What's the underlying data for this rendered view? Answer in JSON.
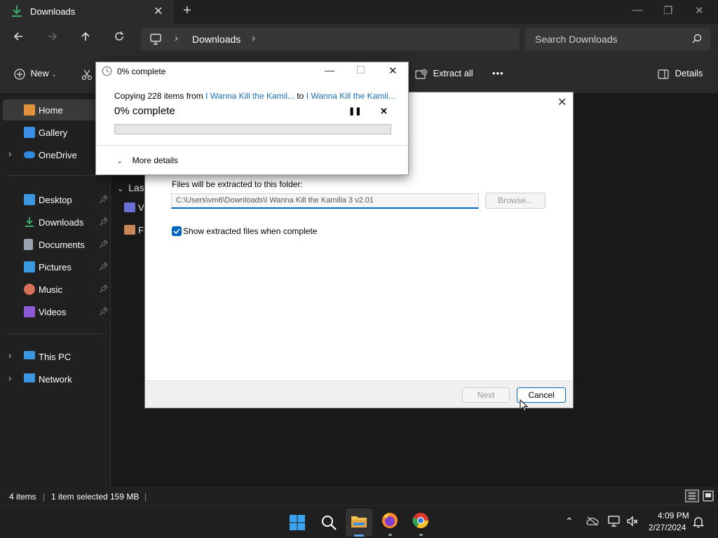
{
  "titlebar": {
    "tab_label": "Downloads",
    "new_tab": "+",
    "minimize": "—",
    "maximize": "❐",
    "close": "✕"
  },
  "address": {
    "breadcrumb": "Downloads",
    "search_placeholder": "Search Downloads"
  },
  "commands": {
    "new_label": "New",
    "extract_all": "Extract all",
    "more": "•••",
    "details": "Details"
  },
  "sidebar": {
    "items": [
      {
        "label": "Home",
        "icon": "home-icon",
        "color": "#e0913a"
      },
      {
        "label": "Gallery",
        "icon": "gallery-icon",
        "color": "#3a8ee6"
      },
      {
        "label": "OneDrive",
        "icon": "onedrive-icon",
        "color": "#2c8be0"
      },
      {
        "label": "Desktop",
        "icon": "desktop-icon",
        "color": "#3a97e0"
      },
      {
        "label": "Downloads",
        "icon": "downloads-icon",
        "color": "#3cae6b"
      },
      {
        "label": "Documents",
        "icon": "documents-icon",
        "color": "#9aa4b0"
      },
      {
        "label": "Pictures",
        "icon": "pictures-icon",
        "color": "#3a9ae0"
      },
      {
        "label": "Music",
        "icon": "music-icon",
        "color": "#d9705a"
      },
      {
        "label": "Videos",
        "icon": "videos-icon",
        "color": "#8d5ad6"
      },
      {
        "label": "This PC",
        "icon": "this-pc-icon",
        "color": "#3a97e0"
      },
      {
        "label": "Network",
        "icon": "network-icon",
        "color": "#3a97e0"
      }
    ]
  },
  "content": {
    "section_label": "Last",
    "row1_label": "V",
    "row2_label": "F"
  },
  "status": {
    "items": "4 items",
    "selected": "1 item selected",
    "size": "159 MB"
  },
  "taskbar": {
    "time": "4:09 PM",
    "date": "2/27/2024"
  },
  "wizard": {
    "folder_label": "Files will be extracted to this folder:",
    "folder_path": "C:\\Users\\vm6\\Downloads\\I Wanna Kill the Kamilia 3 v2.01",
    "browse": "Browse...",
    "show_files": "Show extracted files when complete",
    "next": "Next",
    "cancel": "Cancel"
  },
  "progress": {
    "title": "0% complete",
    "copying_prefix": "Copying 228 items from ",
    "source": "I Wanna Kill the Kamil...",
    "to": " to ",
    "dest": "I Wanna Kill the Kamil...",
    "percent": "0% complete",
    "more_details": "More details",
    "progress_fraction": 0
  }
}
